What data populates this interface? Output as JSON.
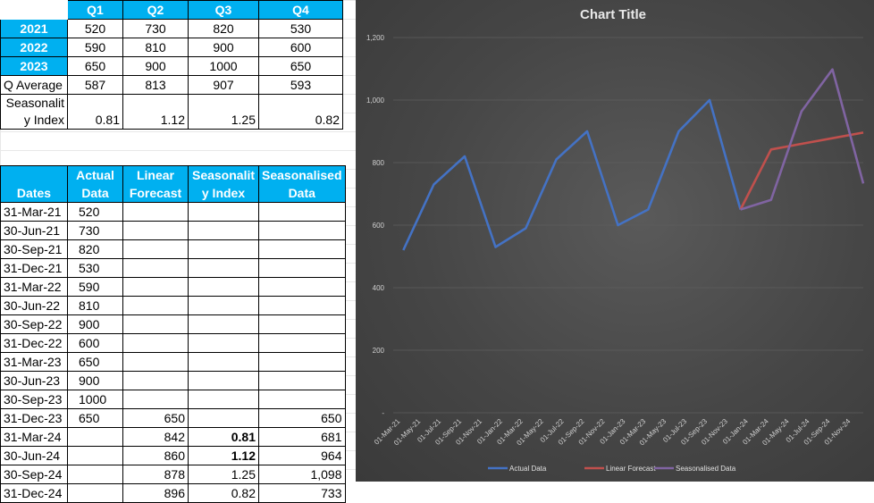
{
  "summary_table": {
    "headers": [
      "",
      "Q1",
      "Q2",
      "Q3",
      "Q4"
    ],
    "rows": [
      {
        "label": "2021",
        "values": [
          "520",
          "730",
          "820",
          "530"
        ]
      },
      {
        "label": "2022",
        "values": [
          "590",
          "810",
          "900",
          "600"
        ]
      },
      {
        "label": "2023",
        "values": [
          "650",
          "900",
          "1000",
          "650"
        ]
      },
      {
        "label": "Q Average",
        "values": [
          "587",
          "813",
          "907",
          "593"
        ]
      },
      {
        "label": "Seasonalit y Index",
        "values": [
          "0.81",
          "1.12",
          "1.25",
          "0.82"
        ]
      }
    ]
  },
  "forecast_table": {
    "headers": [
      "Dates",
      "Actual Data",
      "Linear Forecast",
      "Seasonalit y Index",
      "Seasonalised Data"
    ],
    "rows": [
      [
        "31-Mar-21",
        "520",
        "",
        "",
        ""
      ],
      [
        "30-Jun-21",
        "730",
        "",
        "",
        ""
      ],
      [
        "30-Sep-21",
        "820",
        "",
        "",
        ""
      ],
      [
        "31-Dec-21",
        "530",
        "",
        "",
        ""
      ],
      [
        "31-Mar-22",
        "590",
        "",
        "",
        ""
      ],
      [
        "30-Jun-22",
        "810",
        "",
        "",
        ""
      ],
      [
        "30-Sep-22",
        "900",
        "",
        "",
        ""
      ],
      [
        "31-Dec-22",
        "600",
        "",
        "",
        ""
      ],
      [
        "31-Mar-23",
        "650",
        "",
        "",
        ""
      ],
      [
        "30-Jun-23",
        "900",
        "",
        "",
        ""
      ],
      [
        "30-Sep-23",
        "1000",
        "",
        "",
        ""
      ],
      [
        "31-Dec-23",
        "650",
        "650",
        "",
        "650"
      ],
      [
        "31-Mar-24",
        "",
        "842",
        "0.81",
        "681"
      ],
      [
        "30-Jun-24",
        "",
        "860",
        "1.12",
        "964"
      ],
      [
        "30-Sep-24",
        "",
        "878",
        "1.25",
        "1,098"
      ],
      [
        "31-Dec-24",
        "",
        "896",
        "0.82",
        "733"
      ]
    ]
  },
  "chart_data": {
    "type": "line",
    "title": "Chart Title",
    "xlabel": "",
    "ylabel": "",
    "ylim": [
      0,
      1200
    ],
    "y_ticks": [
      "-",
      "200",
      "400",
      "600",
      "800",
      "1,000",
      "1,200"
    ],
    "y_tick_values": [
      0,
      200,
      400,
      600,
      800,
      1000,
      1200
    ],
    "x_ticks": [
      "01-Mar-21",
      "01-May-21",
      "01-Jul-21",
      "01-Sep-21",
      "01-Nov-21",
      "01-Jan-22",
      "01-Mar-22",
      "01-May-22",
      "01-Jul-22",
      "01-Sep-22",
      "01-Nov-22",
      "01-Jan-23",
      "01-Mar-23",
      "01-May-23",
      "01-Jul-23",
      "01-Sep-23",
      "01-Nov-23",
      "01-Jan-24",
      "01-Mar-24",
      "01-May-24",
      "01-Jul-24",
      "01-Sep-24",
      "01-Nov-24"
    ],
    "x_range": [
      "2021-03-01",
      "2024-12-31"
    ],
    "grid": "horizontal",
    "legend": "bottom",
    "series": [
      {
        "name": "Actual Data",
        "color": "#4472c4",
        "points": [
          [
            "2021-03-31",
            520
          ],
          [
            "2021-06-30",
            730
          ],
          [
            "2021-09-30",
            820
          ],
          [
            "2021-12-31",
            530
          ],
          [
            "2022-03-31",
            590
          ],
          [
            "2022-06-30",
            810
          ],
          [
            "2022-09-30",
            900
          ],
          [
            "2022-12-31",
            600
          ],
          [
            "2023-03-31",
            650
          ],
          [
            "2023-06-30",
            900
          ],
          [
            "2023-09-30",
            1000
          ],
          [
            "2023-12-31",
            650
          ]
        ]
      },
      {
        "name": "Linear Forecast",
        "color": "#c0504d",
        "points": [
          [
            "2023-12-31",
            650
          ],
          [
            "2024-03-31",
            842
          ],
          [
            "2024-06-30",
            860
          ],
          [
            "2024-09-30",
            878
          ],
          [
            "2024-12-31",
            896
          ]
        ]
      },
      {
        "name": "Seasonalised Data",
        "color": "#8064a2",
        "points": [
          [
            "2023-12-31",
            650
          ],
          [
            "2024-03-31",
            681
          ],
          [
            "2024-06-30",
            964
          ],
          [
            "2024-09-30",
            1098
          ],
          [
            "2024-12-31",
            733
          ]
        ]
      }
    ]
  }
}
